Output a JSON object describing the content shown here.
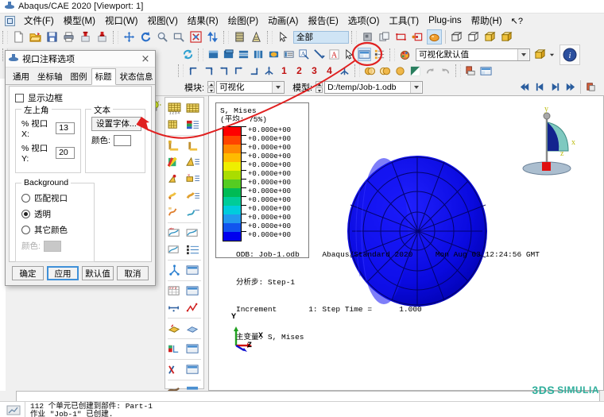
{
  "window": {
    "title": "Abaqus/CAE 2020 [Viewport: 1]"
  },
  "menubar": {
    "items": [
      {
        "label": "文件(F)"
      },
      {
        "label": "模型(M)"
      },
      {
        "label": "视口(W)"
      },
      {
        "label": "视图(V)"
      },
      {
        "label": "结果(R)"
      },
      {
        "label": "绘图(P)"
      },
      {
        "label": "动画(A)"
      },
      {
        "label": "报告(E)"
      },
      {
        "label": "选项(O)"
      },
      {
        "label": "工具(T)"
      },
      {
        "label": "Plug-ins"
      },
      {
        "label": "帮助(H)"
      },
      {
        "label": "↖?"
      }
    ]
  },
  "toolbar_row1": {
    "file_group": [
      "new-icon",
      "open-icon",
      "save-icon",
      "print-icon",
      "import-icon",
      "export-icon"
    ],
    "view_group": [
      "pan-icon",
      "rotate-icon",
      "magnify-icon",
      "box-zoom-icon",
      "fit-view-icon",
      "cycle-views-icon"
    ],
    "render_group": [
      "render-shaded-icon",
      "render-wire-icon"
    ],
    "select_group": [
      "select-arrow-icon"
    ],
    "selection_filter": "全部",
    "display_group": [
      "plane-icon",
      "copy-view-icon",
      "rect-select-icon",
      "node-select-icon",
      "ball-icon"
    ],
    "cube_group": [
      "cube-wire-icon",
      "cube-hidden-icon",
      "cube-shaded-icon",
      "cube-render-icon"
    ]
  },
  "toolbar_row2": {
    "icons": [
      "refresh-icon",
      "contour-plot-icon",
      "symbol-plot-icon",
      "material-plot-icon",
      "ply-plot-icon",
      "xy-plot-icon",
      "spectrum-icon",
      "query-icon",
      "probe-icon",
      "text-annotation-icon",
      "arrow-annotation-icon",
      "select-cursor-icon",
      "viewport-annotation-icon",
      "layers-icon",
      "color-code-icon"
    ],
    "style_combo": "可视化默认值",
    "cube_dropdown": "view-cube-icon"
  },
  "toolbar_row3": {
    "csys_icons": [
      "csys-yx-icon",
      "csys-yx2-icon",
      "csys-zx-icon",
      "csys-yz-icon",
      "csys-zy-icon",
      "csys-iso-icon"
    ],
    "view_numbers": [
      "1",
      "2",
      "3",
      "4"
    ],
    "extra_icons": [
      "apply-view-icon",
      "translucency1-icon",
      "translucency2-icon",
      "translucency3-icon",
      "light-icon",
      "undo-view-icon",
      "redo-view-icon",
      "ruler-icon",
      "table-icon"
    ]
  },
  "modulebar": {
    "module_label": "模块:",
    "module_value": "可视化",
    "model_label": "模型:",
    "model_value": "D:/temp/Job-1.odb",
    "playback": [
      "first-frame-icon",
      "previous-frame-icon",
      "next-frame-icon",
      "last-frame-icon"
    ],
    "animate_icon": "animate-icon"
  },
  "dialog": {
    "title": "视口注释选项",
    "close_label": "×",
    "tabs": [
      {
        "label": "通用",
        "active": false
      },
      {
        "label": "坐标轴",
        "active": false
      },
      {
        "label": "图例",
        "active": false
      },
      {
        "label": "标题",
        "active": true
      },
      {
        "label": "状态信息",
        "active": false
      }
    ],
    "show_border": {
      "label": "显示边框",
      "checked": false
    },
    "position_group": {
      "title": "左上角",
      "x_label": "% 视口 X:",
      "x_value": "13",
      "y_label": "% 视口 Y:",
      "y_value": "20"
    },
    "text_group": {
      "title": "文本",
      "font_button": "设置字体...",
      "color_label": "颜色:",
      "color_value": "#ffffff"
    },
    "background_group": {
      "title": "Background",
      "options": [
        {
          "label": "匹配视口",
          "selected": false
        },
        {
          "label": "透明",
          "selected": true
        },
        {
          "label": "其它颜色",
          "selected": false
        }
      ],
      "color_label": "颜色:",
      "color_value": "#c8c8c8",
      "color_disabled": true
    },
    "buttons": [
      {
        "label": "确定",
        "primary": false
      },
      {
        "label": "应用",
        "primary": true
      },
      {
        "label": "默认值",
        "primary": false
      },
      {
        "label": "取消",
        "primary": false
      }
    ]
  },
  "viewport": {
    "legend": {
      "title_line1": "S, Mises",
      "title_line2": "(平均: 75%)",
      "labels": [
        "+0.000e+00",
        "+0.000e+00",
        "+0.000e+00",
        "+0.000e+00",
        "+0.000e+00",
        "+0.000e+00",
        "+0.000e+00",
        "+0.000e+00",
        "+0.000e+00",
        "+0.000e+00",
        "+0.000e+00",
        "+0.000e+00",
        "+0.000e+00"
      ],
      "colors": [
        "#ff0000",
        "#ff4400",
        "#ff8800",
        "#ffbb00",
        "#eeee00",
        "#aadd00",
        "#55cc22",
        "#00bb55",
        "#00cc99",
        "#00ccdd",
        "#2299ee",
        "#1155ee",
        "#0000ee"
      ]
    },
    "footer": {
      "line1": "ODB: Job-1.odb     Abaqus/Standard 2020     Mon Aug 03 12:24:56 GMT",
      "line2": "分析步: Step-1",
      "line3": "Increment       1: Step Time =      1.000",
      "line4": "主变量: S, Mises"
    },
    "triad": {
      "x": "X",
      "y": "Y",
      "z": "Z"
    },
    "nav_widget": {
      "x": "x",
      "y": "y",
      "z": "z"
    },
    "model_color": "#0000dd"
  },
  "toolbox": {
    "icons": [
      "plot-undeformed-icon",
      "plot-deformed-icon",
      "plot-contours-icon",
      "plot-symbols-icon",
      "allow-multiple-icon",
      "common-options-icon",
      "superimpose-icon",
      "contour-options-icon",
      "symbol-options-icon",
      "material-options-icon",
      "ply-options-icon",
      "result-options-icon",
      "xy-data-create-icon",
      "xy-data-plot-icon",
      "xy-data-manager-icon",
      "xy-options-icon",
      "probe-values-icon",
      "field-output-icon",
      "create-display-group-icon",
      "display-group-manager-icon",
      "path-create-icon",
      "path-plot-icon",
      "free-body-icon",
      "free-body-manager-icon",
      "stress-lines-icon",
      "stress-options-icon",
      "cut-create-icon",
      "cut-manager-icon",
      "stream-icon",
      "stream-options-icon"
    ],
    "tip_icon": "lightbulb-icon"
  },
  "message_pane": {
    "icon": "message-icon",
    "line1": "112 个单元已创建到部件: Part-1",
    "line2": "作业 \"Job-1\" 已创建."
  },
  "branding": {
    "mark": "3DS",
    "text": "SIMULIA"
  },
  "annotations": {
    "arrow_color": "#e02020",
    "circle_color": "#e02020"
  }
}
